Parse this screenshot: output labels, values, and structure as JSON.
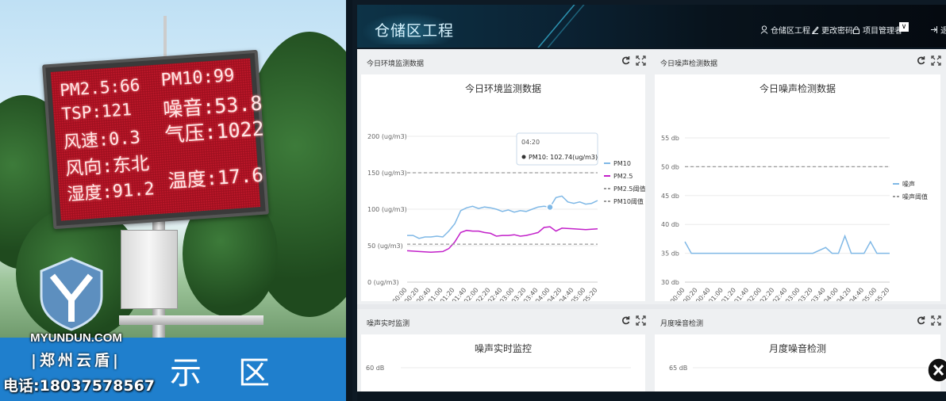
{
  "photo": {
    "sign_lines_left": [
      "PM2.5:66",
      "TSP:121",
      "风速:0.3",
      "风向:东北",
      "湿度:91.2"
    ],
    "sign_lines_right": [
      "PM10:99",
      "噪音:53.8",
      "气压:1022",
      "温度:17.6"
    ],
    "street_chars": [
      "示",
      "区"
    ],
    "logo_text": "MYUNDUN.COM",
    "logo_sub": "|郑州云盾|",
    "phone": "电话:18037578567"
  },
  "header": {
    "title": "仓储区工程",
    "nav": [
      {
        "label": "仓储区工程",
        "icon": "user-icon"
      },
      {
        "label": "更改密码",
        "icon": "pencil-icon"
      },
      {
        "label": "项目管理者",
        "icon": "lock-icon"
      }
    ],
    "dropdown_symbol": "∨",
    "logout_label": "退"
  },
  "panels": {
    "env": {
      "label": "今日环境监测数据",
      "card_title": "今日环境监测数据"
    },
    "noise": {
      "label": "今日噪声检测数据",
      "card_title": "今日噪声检测数据"
    },
    "realtime": {
      "label": "噪声实时监测",
      "card_title": "噪声实时监控"
    },
    "monthly": {
      "label": "月度噪音检测",
      "card_title": "月度噪音检测"
    }
  },
  "tooltip": {
    "time": "04:20",
    "text": "PM10: 102.74(ug/m3)"
  },
  "colors": {
    "pm10": "#7fb8e6",
    "pm25": "#c21fc9",
    "threshold": "#9a9a9a",
    "noise": "#7fb8e6"
  },
  "chart_data": [
    {
      "type": "line",
      "title": "今日环境监测数据",
      "x": [
        "00:00",
        "00:20",
        "00:40",
        "01:00",
        "01:20",
        "01:40",
        "02:00",
        "02:20",
        "02:40",
        "03:00",
        "03:20",
        "03:40",
        "04:00",
        "04:20",
        "04:40",
        "05:00",
        "05:20"
      ],
      "yticks": [
        "0 (ug/m3)",
        "50 (ug/m3)",
        "100 (ug/m3)",
        "150 (ug/m3)",
        "200 (ug/m3)"
      ],
      "ylim": [
        0,
        200
      ],
      "series": [
        {
          "name": "PM10",
          "style": "solid",
          "points": [
            [
              0,
              64
            ],
            [
              0.5,
              64
            ],
            [
              1,
              60
            ],
            [
              1.5,
              62
            ],
            [
              2,
              62
            ],
            [
              2.5,
              63
            ],
            [
              3,
              62
            ],
            [
              3.5,
              70
            ],
            [
              4,
              80
            ],
            [
              4.5,
              98
            ],
            [
              5,
              102
            ],
            [
              5.5,
              104
            ],
            [
              6,
              101
            ],
            [
              6.5,
              103
            ],
            [
              7,
              102
            ],
            [
              7.5,
              100
            ],
            [
              8,
              97
            ],
            [
              8.5,
              99
            ],
            [
              9,
              96
            ],
            [
              9.5,
              98
            ],
            [
              10,
              97
            ],
            [
              10.5,
              100
            ],
            [
              11,
              103
            ],
            [
              11.5,
              104
            ],
            [
              12,
              102.74
            ],
            [
              12.5,
              116
            ],
            [
              13,
              118
            ],
            [
              13.5,
              110
            ],
            [
              14,
              108
            ],
            [
              14.5,
              110
            ],
            [
              15,
              107
            ],
            [
              15.5,
              108
            ],
            [
              16,
              112
            ]
          ]
        },
        {
          "name": "PM2.5",
          "style": "solid",
          "points": [
            [
              0,
              43
            ],
            [
              1,
              42
            ],
            [
              2,
              41
            ],
            [
              3,
              42
            ],
            [
              3.5,
              46
            ],
            [
              4,
              55
            ],
            [
              4.5,
              68
            ],
            [
              5,
              71
            ],
            [
              5.5,
              70
            ],
            [
              6,
              70
            ],
            [
              6.5,
              68
            ],
            [
              7,
              67
            ],
            [
              7.5,
              63
            ],
            [
              8,
              64
            ],
            [
              8.5,
              64
            ],
            [
              9,
              65
            ],
            [
              9.5,
              63
            ],
            [
              10,
              64
            ],
            [
              10.5,
              66
            ],
            [
              11,
              68
            ],
            [
              11.5,
              75
            ],
            [
              12,
              76
            ],
            [
              12.5,
              70
            ],
            [
              13,
              74
            ],
            [
              14,
              73
            ],
            [
              15,
              72
            ],
            [
              16,
              73
            ]
          ]
        },
        {
          "name": "PM2.5阈值",
          "style": "dashed",
          "values": [
            52
          ]
        },
        {
          "name": "PM10阈值",
          "style": "dashed",
          "values": [
            150
          ]
        }
      ]
    },
    {
      "type": "line",
      "title": "今日噪声检测数据",
      "x": [
        "00:00",
        "00:20",
        "00:40",
        "01:00",
        "01:20",
        "01:40",
        "02:00",
        "02:20",
        "02:40",
        "03:00",
        "03:20",
        "03:40",
        "04:00",
        "04:20",
        "04:40",
        "05:00",
        "05:20"
      ],
      "yticks": [
        "30 db",
        "35 db",
        "40 db",
        "45 db",
        "50 db",
        "55 db"
      ],
      "ylim": [
        30,
        55
      ],
      "series": [
        {
          "name": "噪声",
          "style": "solid",
          "points": [
            [
              0,
              37
            ],
            [
              0.5,
              35
            ],
            [
              1,
              35
            ],
            [
              2,
              35
            ],
            [
              3,
              35
            ],
            [
              4,
              35
            ],
            [
              5,
              35
            ],
            [
              6,
              35
            ],
            [
              7,
              35
            ],
            [
              8,
              35
            ],
            [
              9,
              35
            ],
            [
              10,
              35
            ],
            [
              11,
              36
            ],
            [
              11.5,
              35
            ],
            [
              12,
              35
            ],
            [
              12.5,
              38
            ],
            [
              13,
              35
            ],
            [
              14,
              35
            ],
            [
              14.5,
              37
            ],
            [
              15,
              35
            ],
            [
              16,
              35
            ]
          ]
        },
        {
          "name": "噪声阈值",
          "style": "dashed",
          "values": [
            50
          ]
        }
      ]
    },
    {
      "type": "line",
      "title": "噪声实时监控",
      "yticks": [
        "60 dB"
      ]
    },
    {
      "type": "line",
      "title": "月度噪音检测",
      "yticks": [
        "65 dB"
      ]
    }
  ]
}
